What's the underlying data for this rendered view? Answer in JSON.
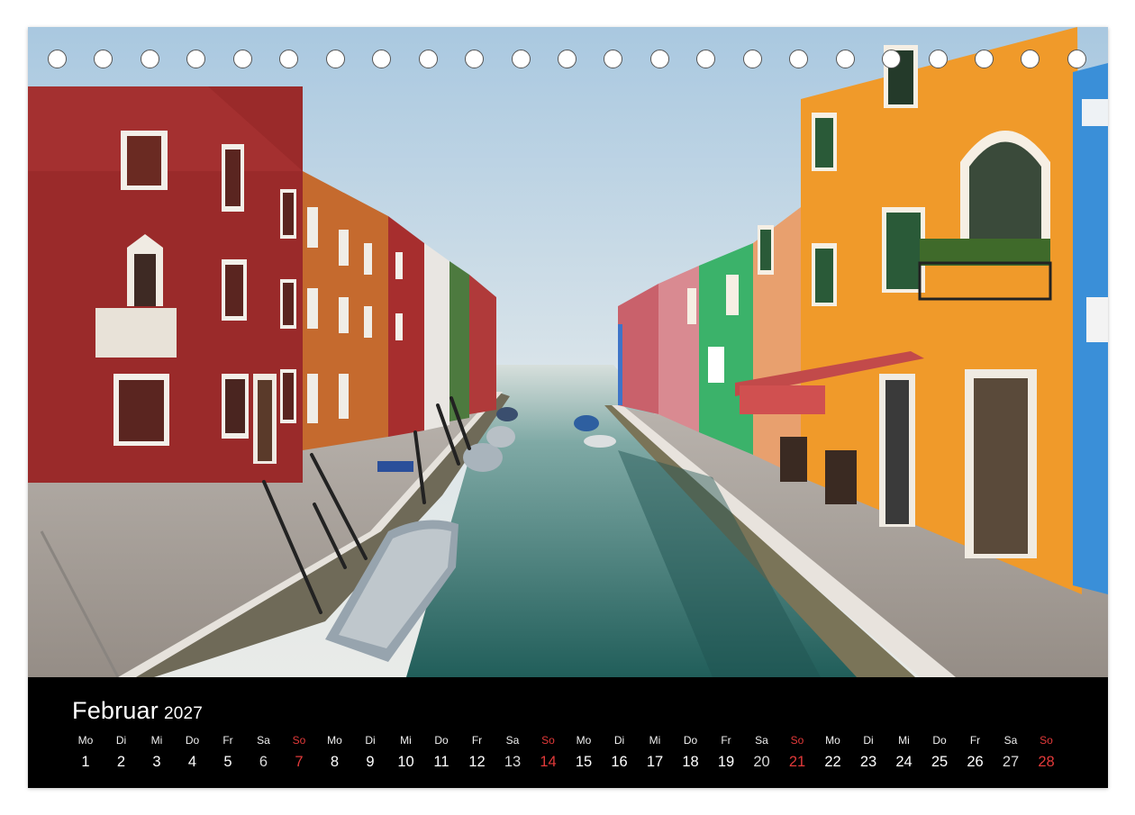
{
  "calendar": {
    "month": "Februar",
    "year": "2027",
    "days": [
      {
        "name": "Mo",
        "num": "1",
        "type": "weekday"
      },
      {
        "name": "Di",
        "num": "2",
        "type": "weekday"
      },
      {
        "name": "Mi",
        "num": "3",
        "type": "weekday"
      },
      {
        "name": "Do",
        "num": "4",
        "type": "weekday"
      },
      {
        "name": "Fr",
        "num": "5",
        "type": "weekday"
      },
      {
        "name": "Sa",
        "num": "6",
        "type": "saturday"
      },
      {
        "name": "So",
        "num": "7",
        "type": "sunday"
      },
      {
        "name": "Mo",
        "num": "8",
        "type": "weekday"
      },
      {
        "name": "Di",
        "num": "9",
        "type": "weekday"
      },
      {
        "name": "Mi",
        "num": "10",
        "type": "weekday"
      },
      {
        "name": "Do",
        "num": "11",
        "type": "weekday"
      },
      {
        "name": "Fr",
        "num": "12",
        "type": "weekday"
      },
      {
        "name": "Sa",
        "num": "13",
        "type": "saturday"
      },
      {
        "name": "So",
        "num": "14",
        "type": "sunday"
      },
      {
        "name": "Mo",
        "num": "15",
        "type": "weekday"
      },
      {
        "name": "Di",
        "num": "16",
        "type": "weekday"
      },
      {
        "name": "Mi",
        "num": "17",
        "type": "weekday"
      },
      {
        "name": "Do",
        "num": "18",
        "type": "weekday"
      },
      {
        "name": "Fr",
        "num": "19",
        "type": "weekday"
      },
      {
        "name": "Sa",
        "num": "20",
        "type": "saturday"
      },
      {
        "name": "So",
        "num": "21",
        "type": "sunday"
      },
      {
        "name": "Mo",
        "num": "22",
        "type": "weekday"
      },
      {
        "name": "Di",
        "num": "23",
        "type": "weekday"
      },
      {
        "name": "Mi",
        "num": "24",
        "type": "weekday"
      },
      {
        "name": "Do",
        "num": "25",
        "type": "weekday"
      },
      {
        "name": "Fr",
        "num": "26",
        "type": "weekday"
      },
      {
        "name": "Sa",
        "num": "27",
        "type": "saturday"
      },
      {
        "name": "So",
        "num": "28",
        "type": "sunday"
      }
    ]
  },
  "colors": {
    "sunday": "#e23a3a",
    "bar": "#000000",
    "sky": "#c9dcea",
    "water": "#3f7f7c"
  },
  "binding_holes": {
    "count": 23
  }
}
